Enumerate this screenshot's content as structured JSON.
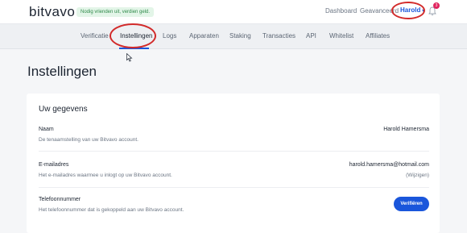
{
  "header": {
    "logo": "bitvavo",
    "promo": "Nodig vrienden uit, verdien geld.",
    "dashboard": "Dashboard",
    "advanced": "Geavanceerd",
    "user": "Harold",
    "notifications": "3"
  },
  "subnav": {
    "items": [
      {
        "label": "Verificatie"
      },
      {
        "label": "Instellingen"
      },
      {
        "label": "Logs"
      },
      {
        "label": "Apparaten"
      },
      {
        "label": "Staking"
      },
      {
        "label": "Transacties"
      },
      {
        "label": "API"
      },
      {
        "label": "Whitelist"
      },
      {
        "label": "Affiliates"
      }
    ],
    "active": "Instellingen"
  },
  "page": {
    "title": "Instellingen"
  },
  "card": {
    "title": "Uw gegevens",
    "rows": [
      {
        "label": "Naam",
        "description": "De tenaamstelling van uw Bitvavo account.",
        "value": "Harold Hamersma"
      },
      {
        "label": "E-mailadres",
        "description": "Het e-mailadres waarmee u inlogt op uw Bitvavo account.",
        "value": "harold.hamersma@hotmail.com",
        "link": "(Wijzigen)"
      },
      {
        "label": "Telefoonnummer",
        "description": "Het telefoonnummer dat is gekoppeld aan uw Bitvavo account.",
        "button": "Verifiëren"
      }
    ]
  },
  "colors": {
    "accent": "#1a56db",
    "annotation": "#d22a2a"
  },
  "icons": {
    "bell": "bell-icon",
    "caret": "chevron-down-icon",
    "cursor": "mouse-cursor-icon"
  }
}
